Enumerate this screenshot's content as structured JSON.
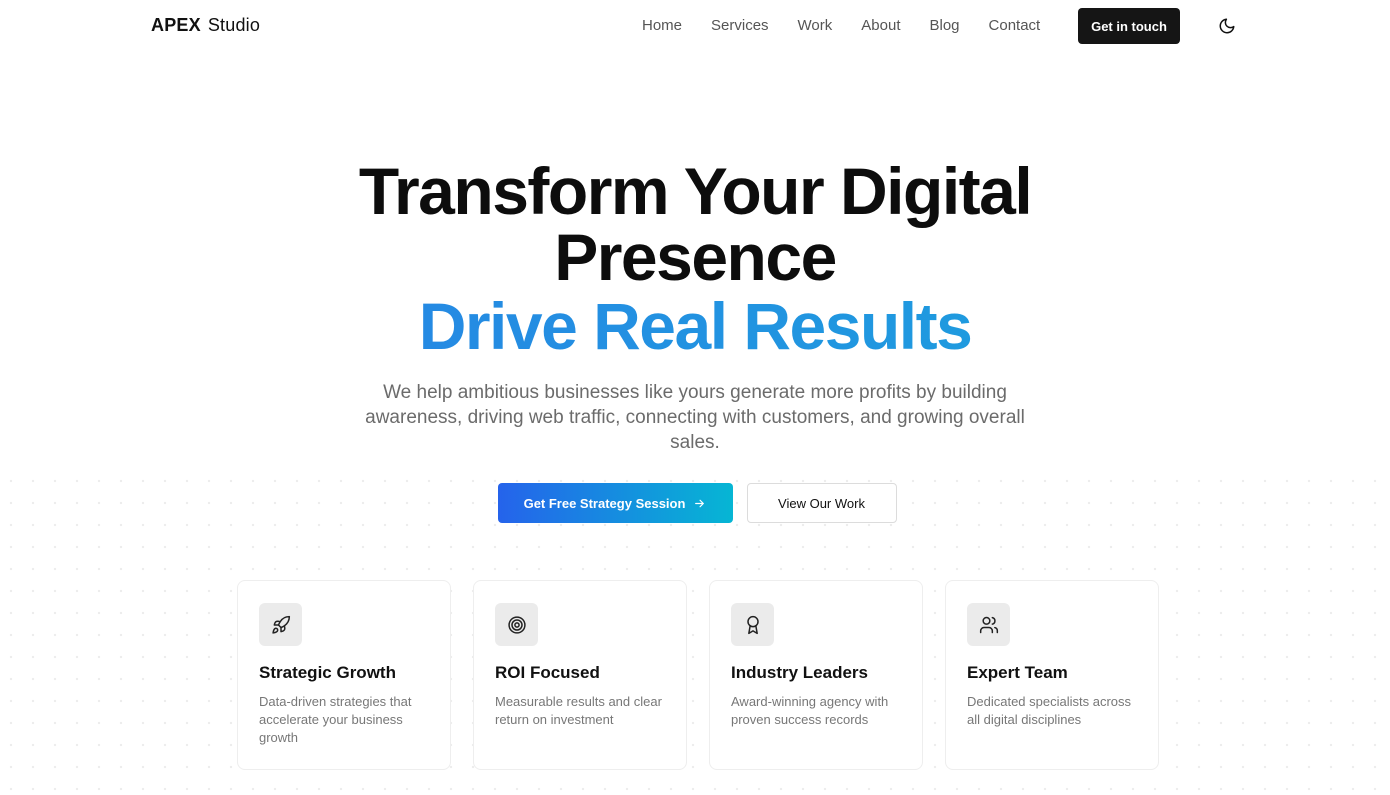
{
  "brand": {
    "bold": "APEX",
    "light": "Studio"
  },
  "nav": {
    "items": [
      {
        "label": "Home"
      },
      {
        "label": "Services"
      },
      {
        "label": "Work"
      },
      {
        "label": "About"
      },
      {
        "label": "Blog"
      },
      {
        "label": "Contact"
      }
    ],
    "cta_label": "Get in touch",
    "theme_icon": "moon-icon"
  },
  "hero": {
    "title_line1": "Transform Your Digital",
    "title_line2": "Presence",
    "title_gradient": "Drive Real Results",
    "subtitle": "We help ambitious businesses like yours generate more profits by building awareness, driving web traffic, connecting with customers, and growing overall sales.",
    "primary_button": "Get Free Strategy Session",
    "primary_button_icon": "arrow-right-icon",
    "secondary_button": "View Our Work"
  },
  "features": [
    {
      "icon": "rocket-icon",
      "title": "Strategic Growth",
      "text": "Data-driven strategies that accelerate your business growth"
    },
    {
      "icon": "target-icon",
      "title": "ROI Focused",
      "text": "Measurable results and clear return on investment"
    },
    {
      "icon": "award-icon",
      "title": "Industry Leaders",
      "text": "Award-winning agency with proven success records"
    },
    {
      "icon": "users-icon",
      "title": "Expert Team",
      "text": "Dedicated specialists across all digital disciplines"
    }
  ],
  "colors": {
    "gradient_start": "#2563eb",
    "gradient_end": "#06b6d4",
    "dark_button": "#151515"
  }
}
